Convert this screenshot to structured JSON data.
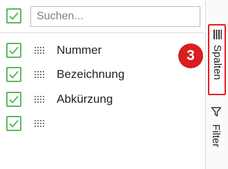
{
  "search": {
    "placeholder": "Suchen..."
  },
  "columns": [
    {
      "label": "Nummer",
      "checked": true
    },
    {
      "label": "Bezeichnung",
      "checked": true
    },
    {
      "label": "Abkürzung",
      "checked": true
    },
    {
      "label": "",
      "checked": true
    }
  ],
  "side_tabs": {
    "columns_label": "Spalten",
    "filter_label": "Filter"
  },
  "annotation": {
    "step_number": "3"
  },
  "colors": {
    "checkbox_accent": "#5cb85c",
    "highlight_border": "#e01e1e",
    "badge_background": "#d81e1e"
  },
  "icons": [
    "check-icon",
    "drag-handle-icon",
    "columns-icon",
    "filter-icon"
  ]
}
